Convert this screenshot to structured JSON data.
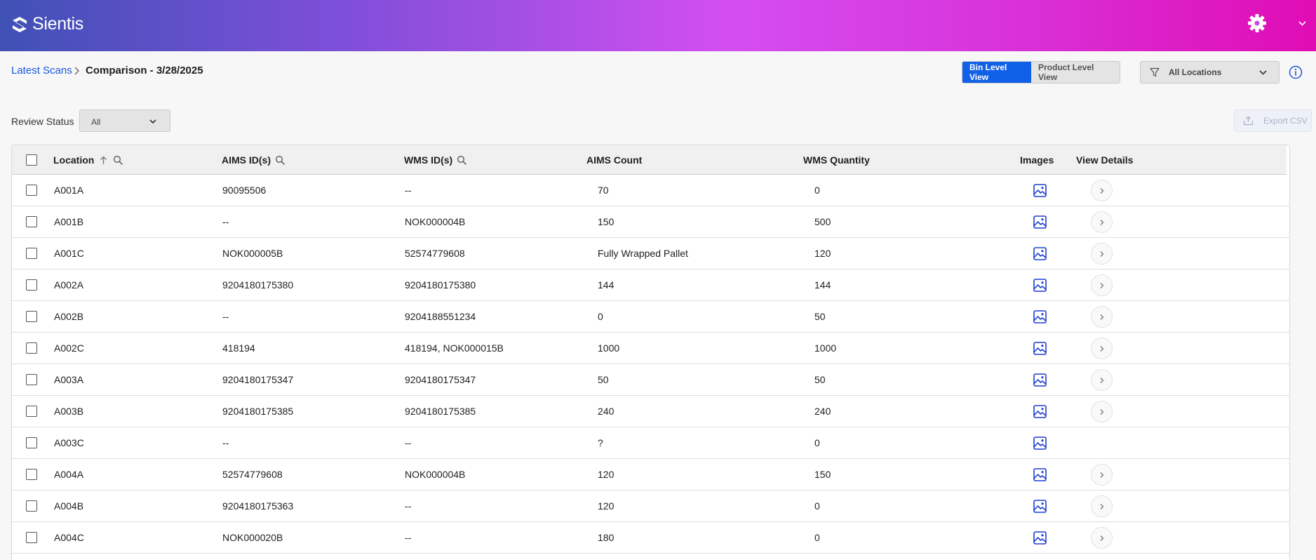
{
  "app": {
    "brand": "Sientis",
    "settings_icon": "gear-icon",
    "account_menu_icon": "chevron-down-icon"
  },
  "breadcrumb": {
    "parent": "Latest Scans",
    "current": "Comparison - 3/28/2025"
  },
  "view_toggle": {
    "bin_level": "Bin Level View",
    "product_level": "Product Level View",
    "selected": "Bin Level View"
  },
  "location_filter": {
    "value": "All Locations"
  },
  "review_status": {
    "label": "Review Status",
    "value": "All"
  },
  "export_button": {
    "label": "Export CSV"
  },
  "table": {
    "headers": {
      "location": "Location",
      "aims_ids": "AIMS ID(s)",
      "wms_ids": "WMS ID(s)",
      "aims_count": "AIMS Count",
      "wms_quantity": "WMS Quantity",
      "images": "Images",
      "view_details": "View Details"
    },
    "rows": [
      {
        "location": "A001A",
        "aims_ids": "90095506",
        "wms_ids": "--",
        "aims_count": "70",
        "wms_quantity": "0",
        "has_details": true
      },
      {
        "location": "A001B",
        "aims_ids": "--",
        "wms_ids": "NOK000004B",
        "aims_count": "150",
        "wms_quantity": "500",
        "has_details": true
      },
      {
        "location": "A001C",
        "aims_ids": "NOK000005B",
        "wms_ids": "52574779608",
        "aims_count": "Fully Wrapped Pallet",
        "wms_quantity": "120",
        "has_details": true
      },
      {
        "location": "A002A",
        "aims_ids": "9204180175380",
        "wms_ids": "9204180175380",
        "aims_count": "144",
        "wms_quantity": "144",
        "has_details": true
      },
      {
        "location": "A002B",
        "aims_ids": "--",
        "wms_ids": "9204188551234",
        "aims_count": "0",
        "wms_quantity": "50",
        "has_details": true
      },
      {
        "location": "A002C",
        "aims_ids": "418194",
        "wms_ids": "418194, NOK000015B",
        "aims_count": "1000",
        "wms_quantity": "1000",
        "has_details": true
      },
      {
        "location": "A003A",
        "aims_ids": "9204180175347",
        "wms_ids": "9204180175347",
        "aims_count": "50",
        "wms_quantity": "50",
        "has_details": true
      },
      {
        "location": "A003B",
        "aims_ids": "9204180175385",
        "wms_ids": "9204180175385",
        "aims_count": "240",
        "wms_quantity": "240",
        "has_details": true
      },
      {
        "location": "A003C",
        "aims_ids": "--",
        "wms_ids": "--",
        "aims_count": "?",
        "wms_quantity": "0",
        "has_details": false
      },
      {
        "location": "A004A",
        "aims_ids": "52574779608",
        "wms_ids": "NOK000004B",
        "aims_count": "120",
        "wms_quantity": "150",
        "has_details": true
      },
      {
        "location": "A004B",
        "aims_ids": "9204180175363",
        "wms_ids": "--",
        "aims_count": "120",
        "wms_quantity": "0",
        "has_details": true
      },
      {
        "location": "A004C",
        "aims_ids": "NOK000020B",
        "wms_ids": "--",
        "aims_count": "180",
        "wms_quantity": "0",
        "has_details": true
      }
    ]
  },
  "colors": {
    "accent": "#1160e8",
    "link": "#1a56db",
    "header_gradient_start": "#3f51b5",
    "header_gradient_end": "#e00cb4"
  }
}
